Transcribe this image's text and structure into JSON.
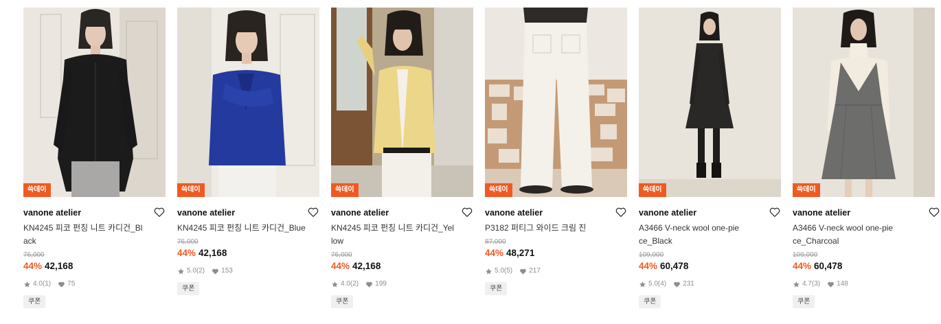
{
  "colors": {
    "accent": "#f05a22",
    "badge_text": "#ffffff"
  },
  "products": [
    {
      "badge": "쓱데이",
      "brand": "vanone atelier",
      "name": "KN4245 피코 펀칭 니트 카디건_Black",
      "original_price": "76,000",
      "discount": "44%",
      "price": "42,168",
      "rating": "4.0",
      "review_count": "(1)",
      "likes": "75",
      "coupon": "쿠폰"
    },
    {
      "badge": "쓱데이",
      "brand": "vanone atelier",
      "name": "KN4245 피코 펀칭 니트 카디건_Blue",
      "original_price": "76,000",
      "discount": "44%",
      "price": "42,168",
      "rating": "5.0",
      "review_count": "(2)",
      "likes": "153",
      "coupon": "쿠폰"
    },
    {
      "badge": "쓱데이",
      "brand": "vanone atelier",
      "name": "KN4245 피코 펀칭 니트 카디건_Yellow",
      "original_price": "76,000",
      "discount": "44%",
      "price": "42,168",
      "rating": "4.0",
      "review_count": "(2)",
      "likes": "199",
      "coupon": "쿠폰"
    },
    {
      "badge": "쓱데이",
      "brand": "vanone atelier",
      "name": "P3182 퍼티그 와이드 크림 진",
      "original_price": "87,000",
      "discount": "44%",
      "price": "48,271",
      "rating": "5.0",
      "review_count": "(5)",
      "likes": "217",
      "coupon": "쿠폰"
    },
    {
      "badge": "쓱데이",
      "brand": "vanone atelier",
      "name": "A3466 V-neck wool one-piece_Black",
      "original_price": "109,000",
      "discount": "44%",
      "price": "60,478",
      "rating": "5.0",
      "review_count": "(4)",
      "likes": "231",
      "coupon": "쿠폰"
    },
    {
      "badge": "쓱데이",
      "brand": "vanone atelier",
      "name": "A3466 V-neck wool one-piece_Charcoal",
      "original_price": "109,000",
      "discount": "44%",
      "price": "60,478",
      "rating": "4.7",
      "review_count": "(3)",
      "likes": "148",
      "coupon": "쿠폰"
    }
  ]
}
